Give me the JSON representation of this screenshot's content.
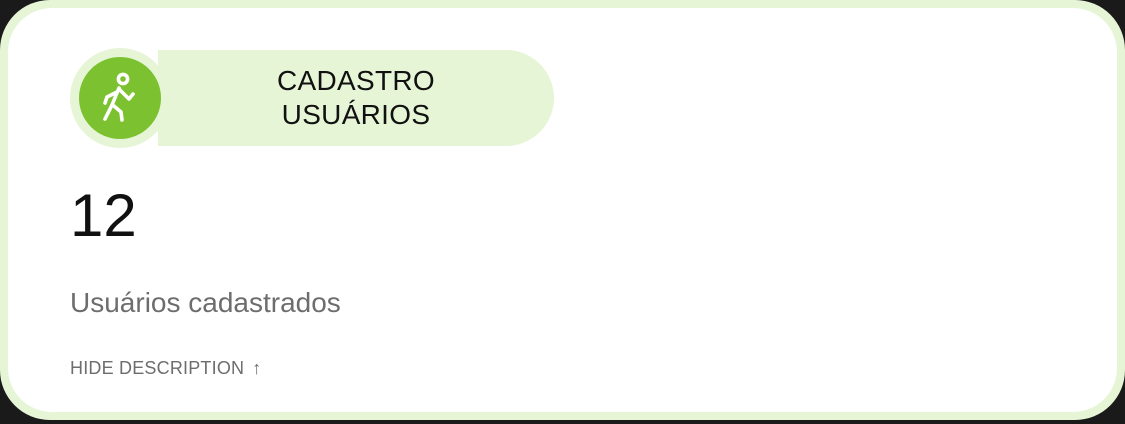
{
  "card": {
    "title": "CADASTRO USUÁRIOS",
    "value": "12",
    "description": "Usuários cadastrados",
    "toggle_label": "HIDE DESCRIPTION",
    "toggle_icon": "arrow-up-icon",
    "badge_icon": "walking-person-icon"
  },
  "colors": {
    "accent_green": "#7cc12f",
    "light_green": "#e6f5d6",
    "text_dark": "#111111",
    "text_muted": "#6d6d6d"
  }
}
